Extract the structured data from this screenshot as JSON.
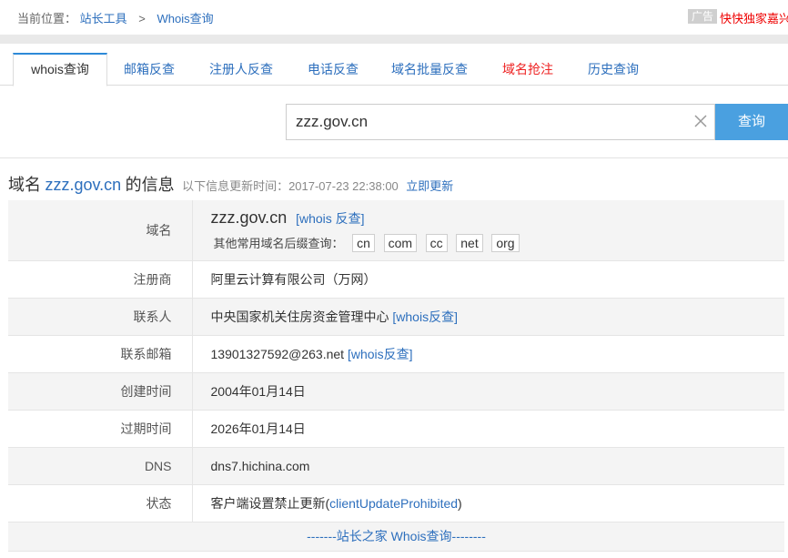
{
  "breadcrumb": {
    "prefix": "当前位置：",
    "items": [
      "站长工具",
      "Whois查询"
    ],
    "separator": ">"
  },
  "ad": {
    "badge": "广告",
    "text": "快快独家嘉兴"
  },
  "tabs": [
    {
      "label": "whois查询",
      "active": true
    },
    {
      "label": "邮箱反查"
    },
    {
      "label": "注册人反查"
    },
    {
      "label": "电话反查"
    },
    {
      "label": "域名批量反查"
    },
    {
      "label": "域名抢注",
      "color": "#e22222"
    },
    {
      "label": "历史查询"
    }
  ],
  "search": {
    "value": "zzz.gov.cn",
    "button": "查询"
  },
  "heading": {
    "prefix": "域名",
    "domain": "zzz.gov.cn",
    "suffix": "的信息",
    "update_text": "以下信息更新时间：2017-07-23 22:38:00",
    "update_link": "立即更新"
  },
  "rows": {
    "domain": {
      "label": "域名",
      "value": "zzz.gov.cn",
      "link": "[whois 反查]",
      "suffix_label": "其他常用域名后缀查询：",
      "suffixes": [
        "cn",
        "com",
        "cc",
        "net",
        "org"
      ]
    },
    "registrar": {
      "label": "注册商",
      "value": "阿里云计算有限公司（万网）"
    },
    "contact": {
      "label": "联系人",
      "value": "中央国家机关住房资金管理中心",
      "link": "[whois反查]"
    },
    "email": {
      "label": "联系邮箱",
      "value": "13901327592@263.net",
      "link": "[whois反查]"
    },
    "created": {
      "label": "创建时间",
      "value": "2004年01月14日"
    },
    "expires": {
      "label": "过期时间",
      "value": "2026年01月14日"
    },
    "dns": {
      "label": "DNS",
      "value": "dns7.hichina.com"
    },
    "status": {
      "label": "状态",
      "value": "客户端设置禁止更新",
      "code": "clientUpdateProhibited"
    }
  },
  "footer": "-------站长之家 Whois查询--------",
  "colors": {
    "accent": "#2d6fbd",
    "button": "#4aa0e0",
    "warning": "#e22222"
  }
}
